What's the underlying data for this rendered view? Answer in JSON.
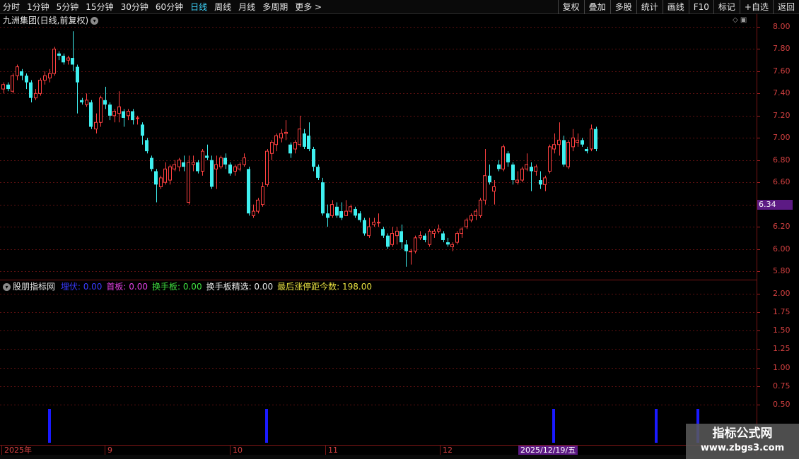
{
  "toolbar": {
    "periods": [
      "分时",
      "1分钟",
      "5分钟",
      "15分钟",
      "30分钟",
      "60分钟",
      "日线",
      "周线",
      "月线",
      "多周期",
      "更多 >"
    ],
    "active_period": "日线",
    "right_buttons": [
      "复权",
      "叠加",
      "多股",
      "统计",
      "画线",
      "F10",
      "标记",
      "+自选",
      "返回"
    ]
  },
  "main": {
    "title": "九洲集团(日线,前复权)",
    "current_price_label": "6.34",
    "y_axis_labels": [
      "8.00",
      "7.80",
      "7.60",
      "7.40",
      "7.20",
      "7.00",
      "6.80",
      "6.60",
      "6.40",
      "6.20",
      "6.00",
      "5.80"
    ]
  },
  "indicator": {
    "name": "股朋指标网",
    "values": [
      {
        "label": "埋伏:",
        "value": "0.00",
        "color": "#3a3aff"
      },
      {
        "label": "首板:",
        "value": "0.00",
        "color": "#e040e0"
      },
      {
        "label": "换手板:",
        "value": "0.00",
        "color": "#40e040"
      },
      {
        "label": "换手板精选:",
        "value": "0.00",
        "color": "#e8e8e8"
      },
      {
        "label": "最后涨停距今数:",
        "value": "198.00",
        "color": "#e8e040"
      }
    ],
    "y_axis_labels": [
      "2.00",
      "1.75",
      "1.50",
      "1.25",
      "1.00",
      "0.75",
      "0.50"
    ]
  },
  "date_axis": {
    "labels": [
      "2025年",
      "9",
      "10",
      "11",
      "12"
    ],
    "cursor": "2025/12/19/五"
  },
  "watermark": {
    "title": "指标公式网",
    "url": "www.zbgs3.com"
  },
  "colors": {
    "up": "#ff4040",
    "down": "#3ff0f0",
    "signal": "#1a1aff",
    "grid": "#5a1010"
  },
  "chart_data": {
    "type": "candlestick",
    "y_range": [
      5.72,
      8.06
    ],
    "candles": [
      [
        7.44,
        7.48,
        7.4,
        7.5
      ],
      [
        7.48,
        7.44,
        7.42,
        7.5
      ],
      [
        7.42,
        7.56,
        7.4,
        7.58
      ],
      [
        7.56,
        7.64,
        7.52,
        7.66
      ],
      [
        7.6,
        7.56,
        7.52,
        7.62
      ],
      [
        7.56,
        7.5,
        7.44,
        7.58
      ],
      [
        7.5,
        7.36,
        7.32,
        7.52
      ],
      [
        7.36,
        7.4,
        7.34,
        7.44
      ],
      [
        7.4,
        7.52,
        7.38,
        7.54
      ],
      [
        7.52,
        7.56,
        7.48,
        7.6
      ],
      [
        7.54,
        7.58,
        7.5,
        7.62
      ],
      [
        7.58,
        7.8,
        7.56,
        7.82
      ],
      [
        7.76,
        7.74,
        7.7,
        7.78
      ],
      [
        7.74,
        7.68,
        7.66,
        7.76
      ],
      [
        7.7,
        7.72,
        7.66,
        7.74
      ],
      [
        7.72,
        7.66,
        7.6,
        7.96
      ],
      [
        7.64,
        7.5,
        7.22,
        7.66
      ],
      [
        7.34,
        7.32,
        7.3,
        7.36
      ],
      [
        7.3,
        7.34,
        7.28,
        7.4
      ],
      [
        7.32,
        7.1,
        7.08,
        7.34
      ],
      [
        7.08,
        7.14,
        7.04,
        7.22
      ],
      [
        7.14,
        7.36,
        7.1,
        7.38
      ],
      [
        7.34,
        7.3,
        7.26,
        7.46
      ],
      [
        7.3,
        7.2,
        7.16,
        7.32
      ],
      [
        7.2,
        7.24,
        7.14,
        7.26
      ],
      [
        7.22,
        7.28,
        7.14,
        7.42
      ],
      [
        7.24,
        7.18,
        7.1,
        7.26
      ],
      [
        7.2,
        7.24,
        7.16,
        7.26
      ],
      [
        7.24,
        7.16,
        7.12,
        7.26
      ],
      [
        7.18,
        7.18,
        7.12,
        7.2
      ],
      [
        7.12,
        7.02,
        6.94,
        7.14
      ],
      [
        6.98,
        6.88,
        6.86,
        7.0
      ],
      [
        6.82,
        6.72,
        6.7,
        6.84
      ],
      [
        6.7,
        6.58,
        6.42,
        6.72
      ],
      [
        6.56,
        6.64,
        6.54,
        6.66
      ],
      [
        6.6,
        6.72,
        6.58,
        6.78
      ],
      [
        6.62,
        6.74,
        6.58,
        6.76
      ],
      [
        6.72,
        6.76,
        6.7,
        6.8
      ],
      [
        6.74,
        6.8,
        6.7,
        6.82
      ],
      [
        6.78,
        6.74,
        6.7,
        6.84
      ],
      [
        6.42,
        6.78,
        6.4,
        6.84
      ],
      [
        6.76,
        6.78,
        6.7,
        6.84
      ],
      [
        6.78,
        6.7,
        6.68,
        6.8
      ],
      [
        6.7,
        6.88,
        6.66,
        6.9
      ],
      [
        6.84,
        6.82,
        6.8,
        6.94
      ],
      [
        6.8,
        6.56,
        6.54,
        6.84
      ],
      [
        6.72,
        6.76,
        6.54,
        6.84
      ],
      [
        6.74,
        6.82,
        6.72,
        6.84
      ],
      [
        6.82,
        6.76,
        6.72,
        6.86
      ],
      [
        6.76,
        6.68,
        6.66,
        6.78
      ],
      [
        6.7,
        6.74,
        6.66,
        6.76
      ],
      [
        6.72,
        6.76,
        6.7,
        6.78
      ],
      [
        6.76,
        6.82,
        6.74,
        6.86
      ],
      [
        6.72,
        6.32,
        6.3,
        6.74
      ],
      [
        6.3,
        6.34,
        6.28,
        6.4
      ],
      [
        6.34,
        6.44,
        6.32,
        6.46
      ],
      [
        6.4,
        6.56,
        6.38,
        6.6
      ],
      [
        6.58,
        6.88,
        6.56,
        6.9
      ],
      [
        6.86,
        6.96,
        6.8,
        6.98
      ],
      [
        6.94,
        7.02,
        6.88,
        7.04
      ],
      [
        7.0,
        7.04,
        6.96,
        7.08
      ],
      [
        7.04,
        7.05,
        6.98,
        7.16
      ],
      [
        6.94,
        6.86,
        6.82,
        6.96
      ],
      [
        6.9,
        6.96,
        6.86,
        6.98
      ],
      [
        6.94,
        7.08,
        6.92,
        7.2
      ],
      [
        7.04,
        6.92,
        6.9,
        7.08
      ],
      [
        7.02,
        6.9,
        6.88,
        7.14
      ],
      [
        6.9,
        6.74,
        6.7,
        6.92
      ],
      [
        6.74,
        6.64,
        6.62,
        6.76
      ],
      [
        6.6,
        6.32,
        6.3,
        6.64
      ],
      [
        6.32,
        6.28,
        6.2,
        6.4
      ],
      [
        6.3,
        6.4,
        6.28,
        6.44
      ],
      [
        6.38,
        6.3,
        6.28,
        6.42
      ],
      [
        6.34,
        6.28,
        6.26,
        6.42
      ],
      [
        6.3,
        6.34,
        6.3,
        6.44
      ],
      [
        6.34,
        6.38,
        6.32,
        6.4
      ],
      [
        6.36,
        6.3,
        6.28,
        6.38
      ],
      [
        6.32,
        6.26,
        6.24,
        6.34
      ],
      [
        6.26,
        6.14,
        6.12,
        6.28
      ],
      [
        6.12,
        6.2,
        6.1,
        6.28
      ],
      [
        6.22,
        6.24,
        6.2,
        6.28
      ],
      [
        6.24,
        6.24,
        6.2,
        6.32
      ],
      [
        6.18,
        6.12,
        6.1,
        6.2
      ],
      [
        6.12,
        6.02,
        6.0,
        6.14
      ],
      [
        6.04,
        6.14,
        6.02,
        6.2
      ],
      [
        6.12,
        6.16,
        6.04,
        6.2
      ],
      [
        6.16,
        6.06,
        6.0,
        6.22
      ],
      [
        6.04,
        5.98,
        5.84,
        6.08
      ],
      [
        5.98,
        5.98,
        5.86,
        6.0
      ],
      [
        5.98,
        6.1,
        5.96,
        6.12
      ],
      [
        6.1,
        6.12,
        6.08,
        6.16
      ],
      [
        6.12,
        6.08,
        6.06,
        6.14
      ],
      [
        6.04,
        6.16,
        6.02,
        6.18
      ],
      [
        6.14,
        6.16,
        6.1,
        6.18
      ],
      [
        6.16,
        6.18,
        6.14,
        6.22
      ],
      [
        6.14,
        6.08,
        6.06,
        6.16
      ],
      [
        6.06,
        6.04,
        6.02,
        6.1
      ],
      [
        6.02,
        6.04,
        5.98,
        6.06
      ],
      [
        6.06,
        6.14,
        6.04,
        6.16
      ],
      [
        6.14,
        6.18,
        6.1,
        6.2
      ],
      [
        6.2,
        6.26,
        6.18,
        6.28
      ],
      [
        6.26,
        6.3,
        6.24,
        6.32
      ],
      [
        6.3,
        6.34,
        6.26,
        6.36
      ],
      [
        6.3,
        6.44,
        6.28,
        6.46
      ],
      [
        6.44,
        6.66,
        6.4,
        6.9
      ],
      [
        6.66,
        6.6,
        6.58,
        6.76
      ],
      [
        6.52,
        6.56,
        6.4,
        6.62
      ],
      [
        6.76,
        6.72,
        6.7,
        6.8
      ],
      [
        6.72,
        6.92,
        6.7,
        6.94
      ],
      [
        6.86,
        6.78,
        6.74,
        6.88
      ],
      [
        6.76,
        6.62,
        6.58,
        6.78
      ],
      [
        6.6,
        6.62,
        6.58,
        6.7
      ],
      [
        6.62,
        6.72,
        6.6,
        6.74
      ],
      [
        6.72,
        6.76,
        6.7,
        6.86
      ],
      [
        6.74,
        6.7,
        6.52,
        6.78
      ],
      [
        6.7,
        6.74,
        6.66,
        6.76
      ],
      [
        6.62,
        6.58,
        6.54,
        6.7
      ],
      [
        6.58,
        6.64,
        6.52,
        6.66
      ],
      [
        6.7,
        6.92,
        6.68,
        6.94
      ],
      [
        6.9,
        6.94,
        6.86,
        7.04
      ],
      [
        6.94,
        6.98,
        6.84,
        7.14
      ],
      [
        6.98,
        6.76,
        6.74,
        7.02
      ],
      [
        6.74,
        6.96,
        6.72,
        6.98
      ],
      [
        6.92,
        7.0,
        6.88,
        7.08
      ],
      [
        6.96,
        6.98,
        6.92,
        7.04
      ],
      [
        6.98,
        6.94,
        6.92,
        7.0
      ],
      [
        6.9,
        6.88,
        6.86,
        6.92
      ],
      [
        6.9,
        7.08,
        6.88,
        7.12
      ],
      [
        7.08,
        6.9,
        6.88,
        7.1
      ]
    ],
    "signals": [
      {
        "index": 10,
        "value": 0.5
      },
      {
        "index": 57,
        "value": 0.5
      },
      {
        "index": 119,
        "value": 0.5
      },
      {
        "index": 141,
        "value": 0.5
      },
      {
        "index": 150,
        "value": 0.5
      }
    ],
    "signal_y_range": [
      0,
      2.2
    ]
  }
}
